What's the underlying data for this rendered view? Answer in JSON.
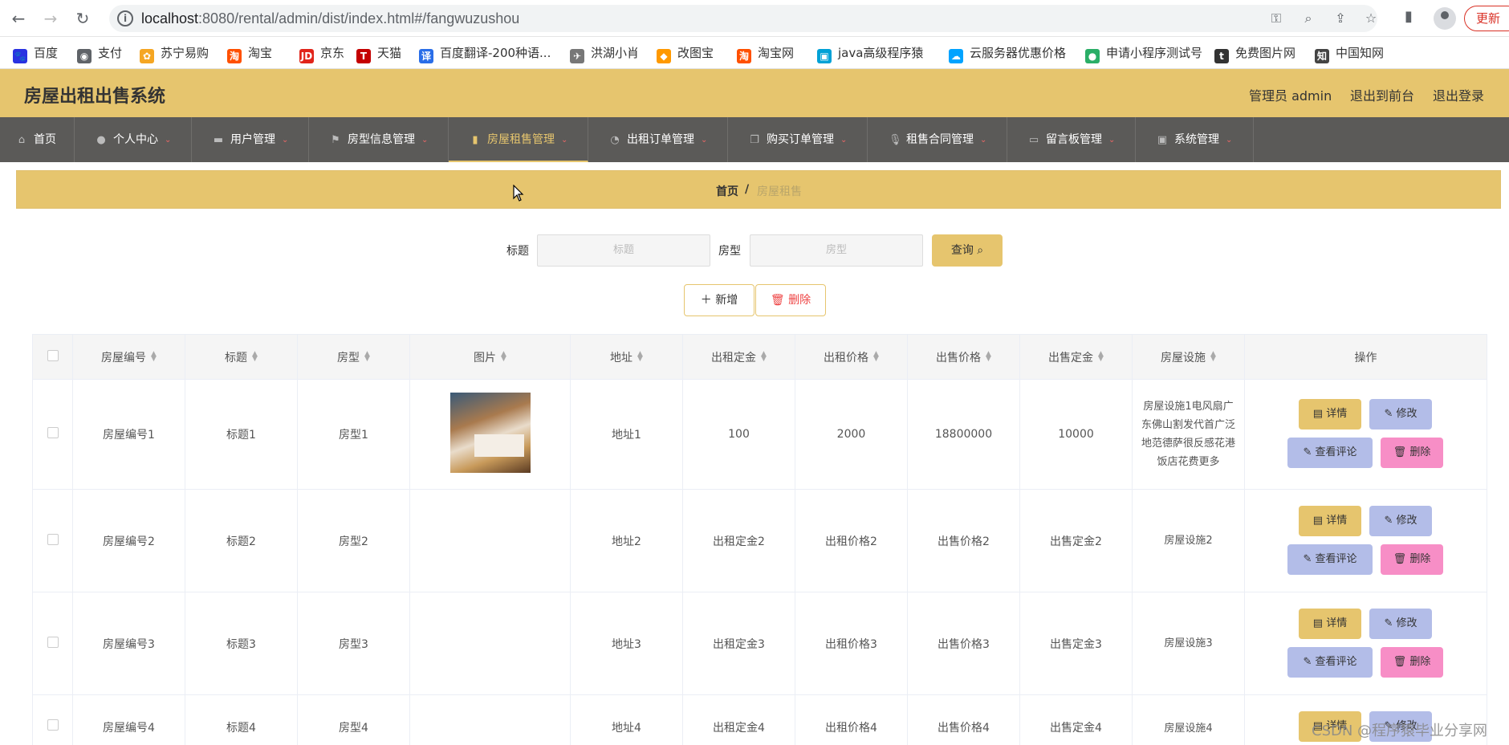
{
  "browser": {
    "url_host": "localhost",
    "url_rest": ":8080/rental/admin/dist/index.html#/fangwuzushou",
    "update_label": "更新"
  },
  "bookmarks": [
    {
      "label": "百度",
      "icon": "baidu-icon",
      "color": "#2932e1"
    },
    {
      "label": "支付",
      "icon": "globe-icon",
      "color": "#5f6368"
    },
    {
      "label": "苏宁易购",
      "icon": "suning-icon",
      "color": "#f5a623"
    },
    {
      "label": "淘宝",
      "icon": "taobao-icon",
      "color": "#ff5000"
    },
    {
      "label": "京东",
      "icon": "jd-icon",
      "color": "#e1251b"
    },
    {
      "label": "天猫",
      "icon": "tmall-icon",
      "color": "#c40000"
    },
    {
      "label": "百度翻译-200种语...",
      "icon": "translate-icon",
      "color": "#2a6ee8"
    },
    {
      "label": "洪湖小肖",
      "icon": "bird-icon",
      "color": "#777777"
    },
    {
      "label": "改图宝",
      "icon": "gaitubao-icon",
      "color": "#ff9900"
    },
    {
      "label": "淘宝网",
      "icon": "taobao-icon",
      "color": "#ff5000"
    },
    {
      "label": "java高级程序猿",
      "icon": "bilibili-icon",
      "color": "#00a1d6"
    },
    {
      "label": "云服务器优惠价格",
      "icon": "cloud-icon",
      "color": "#00a3ff"
    },
    {
      "label": "申请小程序测试号",
      "icon": "wechat-icon",
      "color": "#2aae67"
    },
    {
      "label": "免费图片网",
      "icon": "t-icon",
      "color": "#333333"
    },
    {
      "label": "中国知网",
      "icon": "cnki-icon",
      "color": "#444444"
    }
  ],
  "header": {
    "title": "房屋出租出售系统",
    "admin": "管理员 admin",
    "front": "退出到前台",
    "logout": "退出登录"
  },
  "menu": [
    {
      "label": "首页",
      "icon": "home-icon",
      "caret": false
    },
    {
      "label": "个人中心",
      "icon": "user-icon",
      "caret": true
    },
    {
      "label": "用户管理",
      "icon": "briefcase-icon",
      "caret": true
    },
    {
      "label": "房型信息管理",
      "icon": "flag-icon",
      "caret": true
    },
    {
      "label": "房屋租售管理",
      "icon": "bar-chart-icon",
      "caret": true,
      "active": true
    },
    {
      "label": "出租订单管理",
      "icon": "compass-icon",
      "caret": true
    },
    {
      "label": "购买订单管理",
      "icon": "copy-icon",
      "caret": true
    },
    {
      "label": "租售合同管理",
      "icon": "mic-icon",
      "caret": true
    },
    {
      "label": "留言板管理",
      "icon": "board-icon",
      "caret": true
    },
    {
      "label": "系统管理",
      "icon": "settings-icon",
      "caret": true
    }
  ],
  "breadcrumb": {
    "home": "首页",
    "sep": "/",
    "current": "房屋租售"
  },
  "search": {
    "title_label": "标题",
    "title_placeholder": "标题",
    "type_label": "房型",
    "type_placeholder": "房型",
    "query_label": "查询"
  },
  "actions": {
    "add_label": "新增",
    "delete_label": "删除"
  },
  "table": {
    "columns": [
      "房屋编号",
      "标题",
      "房型",
      "图片",
      "地址",
      "出租定金",
      "出租价格",
      "出售价格",
      "出售定金",
      "房屋设施",
      "操作"
    ],
    "rows": [
      [
        "房屋编号1",
        "标题1",
        "房型1",
        "",
        "地址1",
        "100",
        "2000",
        "18800000",
        "10000",
        "房屋设施1电风扇广东佛山割发代首广泛地范德萨很反感花港饭店花费更多"
      ],
      [
        "房屋编号2",
        "标题2",
        "房型2",
        "",
        "地址2",
        "出租定金2",
        "出租价格2",
        "出售价格2",
        "出售定金2",
        "房屋设施2"
      ],
      [
        "房屋编号3",
        "标题3",
        "房型3",
        "",
        "地址3",
        "出租定金3",
        "出租价格3",
        "出售价格3",
        "出售定金3",
        "房屋设施3"
      ],
      [
        "房屋编号4",
        "标题4",
        "房型4",
        "",
        "地址4",
        "出租定金4",
        "出租价格4",
        "出售价格4",
        "出售定金4",
        "房屋设施4"
      ]
    ],
    "ops": {
      "detail": "详情",
      "edit": "修改",
      "comment": "查看评论",
      "delete": "删除"
    }
  },
  "watermark": "CSDN @程序猿毕业分享网",
  "colors": {
    "accent": "#e6c56e",
    "menu_bg": "#5b5a58",
    "op_blue": "#b3bde8",
    "op_pink": "#f78ec6"
  }
}
